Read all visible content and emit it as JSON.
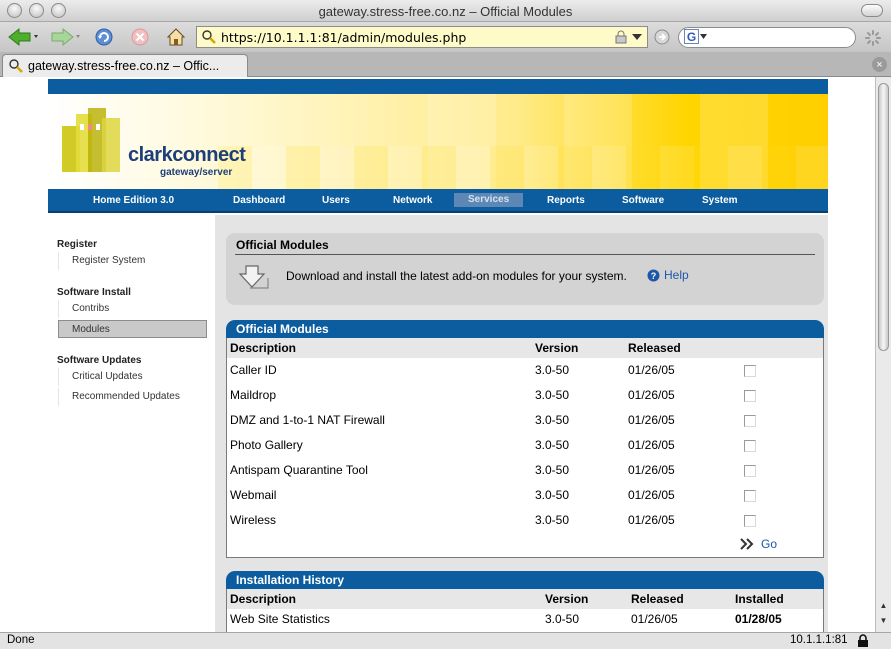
{
  "window": {
    "title": "gateway.stress-free.co.nz – Official Modules",
    "url": "https://10.1.1.1:81/admin/modules.php",
    "search_logo": "G",
    "tab_title": "gateway.stress-free.co.nz – Offic..."
  },
  "status": {
    "left": "Done",
    "right": "10.1.1.1:81"
  },
  "brand": {
    "name": "clarkconnect",
    "tagline": "gateway/server",
    "edition": "Home Edition 3.0"
  },
  "nav": {
    "items": [
      "Dashboard",
      "Users",
      "Network",
      "Services",
      "Reports",
      "Software",
      "System"
    ],
    "active": "Services"
  },
  "sidebar": {
    "sections": [
      {
        "heading": "Register",
        "items": [
          "Register System"
        ]
      },
      {
        "heading": "Software Install",
        "items": [
          "Contribs",
          "Modules"
        ]
      },
      {
        "heading": "Software Updates",
        "items": [
          "Critical Updates",
          "Recommended Updates"
        ]
      }
    ],
    "active_item": "Modules"
  },
  "header_panel": {
    "title": "Official Modules",
    "description": "Download and install the latest add-on modules for your system.",
    "help_label": "Help"
  },
  "modules_table": {
    "title": "Official Modules",
    "columns": [
      "Description",
      "Version",
      "Released"
    ],
    "rows": [
      {
        "description": "Caller ID",
        "version": "3.0-50",
        "released": "01/26/05",
        "checked": false
      },
      {
        "description": "Maildrop",
        "version": "3.0-50",
        "released": "01/26/05",
        "checked": false
      },
      {
        "description": "DMZ and 1-to-1 NAT Firewall",
        "version": "3.0-50",
        "released": "01/26/05",
        "checked": false
      },
      {
        "description": "Photo Gallery",
        "version": "3.0-50",
        "released": "01/26/05",
        "checked": false
      },
      {
        "description": "Antispam Quarantine Tool",
        "version": "3.0-50",
        "released": "01/26/05",
        "checked": false
      },
      {
        "description": "Webmail",
        "version": "3.0-50",
        "released": "01/26/05",
        "checked": false
      },
      {
        "description": "Wireless",
        "version": "3.0-50",
        "released": "01/26/05",
        "checked": false
      }
    ],
    "go_label": "Go"
  },
  "history_table": {
    "title": "Installation History",
    "columns": [
      "Description",
      "Version",
      "Released",
      "Installed"
    ],
    "rows": [
      {
        "description": "Web Site Statistics",
        "version": "3.0-50",
        "released": "01/26/05",
        "installed": "01/28/05"
      }
    ]
  }
}
